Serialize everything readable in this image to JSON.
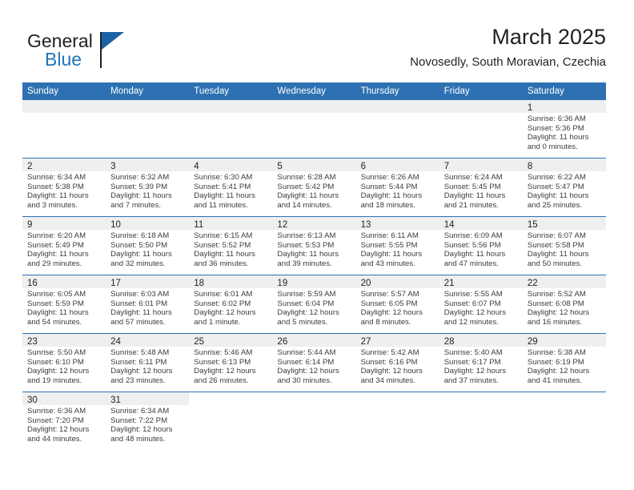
{
  "brand": {
    "name_top": "General",
    "name_bottom": "Blue",
    "mark_icon": "triangle-flag-icon",
    "accent_color": "#1e76bd"
  },
  "header": {
    "title": "March 2025",
    "subtitle": "Novosedly, South Moravian, Czechia"
  },
  "calendar": {
    "header_color": "#2e71b2",
    "band_color": "#efefef",
    "weekdays": [
      "Sunday",
      "Monday",
      "Tuesday",
      "Wednesday",
      "Thursday",
      "Friday",
      "Saturday"
    ],
    "weeks": [
      [
        {
          "empty": true
        },
        {
          "empty": true
        },
        {
          "empty": true
        },
        {
          "empty": true
        },
        {
          "empty": true
        },
        {
          "empty": true
        },
        {
          "day": "1",
          "sunrise": "Sunrise: 6:36 AM",
          "sunset": "Sunset: 5:36 PM",
          "daylight_1": "Daylight: 11 hours",
          "daylight_2": "and 0 minutes."
        }
      ],
      [
        {
          "day": "2",
          "sunrise": "Sunrise: 6:34 AM",
          "sunset": "Sunset: 5:38 PM",
          "daylight_1": "Daylight: 11 hours",
          "daylight_2": "and 3 minutes."
        },
        {
          "day": "3",
          "sunrise": "Sunrise: 6:32 AM",
          "sunset": "Sunset: 5:39 PM",
          "daylight_1": "Daylight: 11 hours",
          "daylight_2": "and 7 minutes."
        },
        {
          "day": "4",
          "sunrise": "Sunrise: 6:30 AM",
          "sunset": "Sunset: 5:41 PM",
          "daylight_1": "Daylight: 11 hours",
          "daylight_2": "and 11 minutes."
        },
        {
          "day": "5",
          "sunrise": "Sunrise: 6:28 AM",
          "sunset": "Sunset: 5:42 PM",
          "daylight_1": "Daylight: 11 hours",
          "daylight_2": "and 14 minutes."
        },
        {
          "day": "6",
          "sunrise": "Sunrise: 6:26 AM",
          "sunset": "Sunset: 5:44 PM",
          "daylight_1": "Daylight: 11 hours",
          "daylight_2": "and 18 minutes."
        },
        {
          "day": "7",
          "sunrise": "Sunrise: 6:24 AM",
          "sunset": "Sunset: 5:45 PM",
          "daylight_1": "Daylight: 11 hours",
          "daylight_2": "and 21 minutes."
        },
        {
          "day": "8",
          "sunrise": "Sunrise: 6:22 AM",
          "sunset": "Sunset: 5:47 PM",
          "daylight_1": "Daylight: 11 hours",
          "daylight_2": "and 25 minutes."
        }
      ],
      [
        {
          "day": "9",
          "sunrise": "Sunrise: 6:20 AM",
          "sunset": "Sunset: 5:49 PM",
          "daylight_1": "Daylight: 11 hours",
          "daylight_2": "and 29 minutes."
        },
        {
          "day": "10",
          "sunrise": "Sunrise: 6:18 AM",
          "sunset": "Sunset: 5:50 PM",
          "daylight_1": "Daylight: 11 hours",
          "daylight_2": "and 32 minutes."
        },
        {
          "day": "11",
          "sunrise": "Sunrise: 6:15 AM",
          "sunset": "Sunset: 5:52 PM",
          "daylight_1": "Daylight: 11 hours",
          "daylight_2": "and 36 minutes."
        },
        {
          "day": "12",
          "sunrise": "Sunrise: 6:13 AM",
          "sunset": "Sunset: 5:53 PM",
          "daylight_1": "Daylight: 11 hours",
          "daylight_2": "and 39 minutes."
        },
        {
          "day": "13",
          "sunrise": "Sunrise: 6:11 AM",
          "sunset": "Sunset: 5:55 PM",
          "daylight_1": "Daylight: 11 hours",
          "daylight_2": "and 43 minutes."
        },
        {
          "day": "14",
          "sunrise": "Sunrise: 6:09 AM",
          "sunset": "Sunset: 5:56 PM",
          "daylight_1": "Daylight: 11 hours",
          "daylight_2": "and 47 minutes."
        },
        {
          "day": "15",
          "sunrise": "Sunrise: 6:07 AM",
          "sunset": "Sunset: 5:58 PM",
          "daylight_1": "Daylight: 11 hours",
          "daylight_2": "and 50 minutes."
        }
      ],
      [
        {
          "day": "16",
          "sunrise": "Sunrise: 6:05 AM",
          "sunset": "Sunset: 5:59 PM",
          "daylight_1": "Daylight: 11 hours",
          "daylight_2": "and 54 minutes."
        },
        {
          "day": "17",
          "sunrise": "Sunrise: 6:03 AM",
          "sunset": "Sunset: 6:01 PM",
          "daylight_1": "Daylight: 11 hours",
          "daylight_2": "and 57 minutes."
        },
        {
          "day": "18",
          "sunrise": "Sunrise: 6:01 AM",
          "sunset": "Sunset: 6:02 PM",
          "daylight_1": "Daylight: 12 hours",
          "daylight_2": "and 1 minute."
        },
        {
          "day": "19",
          "sunrise": "Sunrise: 5:59 AM",
          "sunset": "Sunset: 6:04 PM",
          "daylight_1": "Daylight: 12 hours",
          "daylight_2": "and 5 minutes."
        },
        {
          "day": "20",
          "sunrise": "Sunrise: 5:57 AM",
          "sunset": "Sunset: 6:05 PM",
          "daylight_1": "Daylight: 12 hours",
          "daylight_2": "and 8 minutes."
        },
        {
          "day": "21",
          "sunrise": "Sunrise: 5:55 AM",
          "sunset": "Sunset: 6:07 PM",
          "daylight_1": "Daylight: 12 hours",
          "daylight_2": "and 12 minutes."
        },
        {
          "day": "22",
          "sunrise": "Sunrise: 5:52 AM",
          "sunset": "Sunset: 6:08 PM",
          "daylight_1": "Daylight: 12 hours",
          "daylight_2": "and 16 minutes."
        }
      ],
      [
        {
          "day": "23",
          "sunrise": "Sunrise: 5:50 AM",
          "sunset": "Sunset: 6:10 PM",
          "daylight_1": "Daylight: 12 hours",
          "daylight_2": "and 19 minutes."
        },
        {
          "day": "24",
          "sunrise": "Sunrise: 5:48 AM",
          "sunset": "Sunset: 6:11 PM",
          "daylight_1": "Daylight: 12 hours",
          "daylight_2": "and 23 minutes."
        },
        {
          "day": "25",
          "sunrise": "Sunrise: 5:46 AM",
          "sunset": "Sunset: 6:13 PM",
          "daylight_1": "Daylight: 12 hours",
          "daylight_2": "and 26 minutes."
        },
        {
          "day": "26",
          "sunrise": "Sunrise: 5:44 AM",
          "sunset": "Sunset: 6:14 PM",
          "daylight_1": "Daylight: 12 hours",
          "daylight_2": "and 30 minutes."
        },
        {
          "day": "27",
          "sunrise": "Sunrise: 5:42 AM",
          "sunset": "Sunset: 6:16 PM",
          "daylight_1": "Daylight: 12 hours",
          "daylight_2": "and 34 minutes."
        },
        {
          "day": "28",
          "sunrise": "Sunrise: 5:40 AM",
          "sunset": "Sunset: 6:17 PM",
          "daylight_1": "Daylight: 12 hours",
          "daylight_2": "and 37 minutes."
        },
        {
          "day": "29",
          "sunrise": "Sunrise: 5:38 AM",
          "sunset": "Sunset: 6:19 PM",
          "daylight_1": "Daylight: 12 hours",
          "daylight_2": "and 41 minutes."
        }
      ],
      [
        {
          "day": "30",
          "sunrise": "Sunrise: 6:36 AM",
          "sunset": "Sunset: 7:20 PM",
          "daylight_1": "Daylight: 12 hours",
          "daylight_2": "and 44 minutes."
        },
        {
          "day": "31",
          "sunrise": "Sunrise: 6:34 AM",
          "sunset": "Sunset: 7:22 PM",
          "daylight_1": "Daylight: 12 hours",
          "daylight_2": "and 48 minutes."
        },
        {
          "blank": true
        },
        {
          "blank": true
        },
        {
          "blank": true
        },
        {
          "blank": true
        },
        {
          "blank": true
        }
      ]
    ]
  }
}
